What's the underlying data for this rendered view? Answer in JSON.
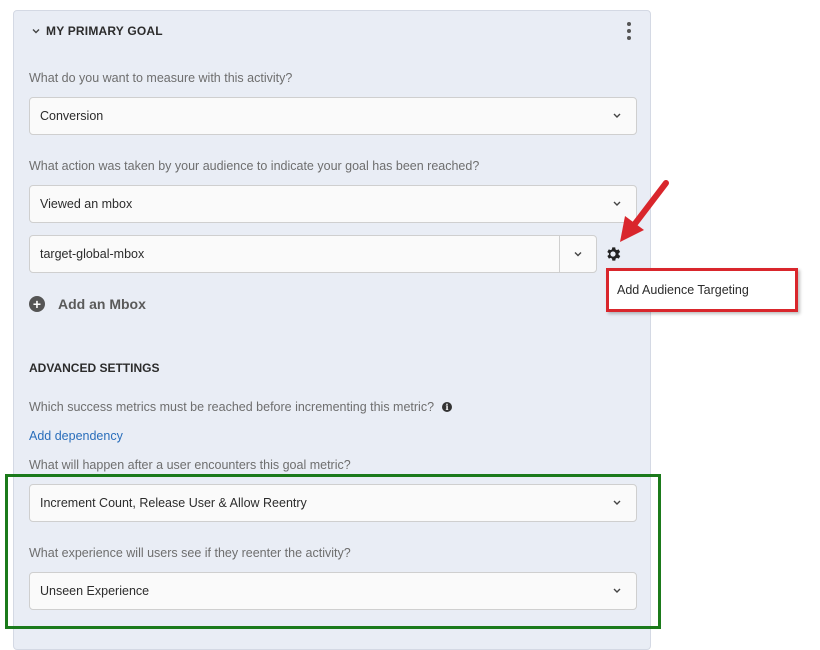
{
  "header": {
    "title": "MY PRIMARY GOAL"
  },
  "measure": {
    "question": "What do you want to measure with this activity?",
    "value": "Conversion"
  },
  "action": {
    "question": "What action was taken by your audience to indicate your goal has been reached?",
    "value": "Viewed an mbox"
  },
  "mbox": {
    "value": "target-global-mbox"
  },
  "add_mbox": {
    "label": "Add an Mbox"
  },
  "popup": {
    "label": "Add Audience Targeting"
  },
  "advanced": {
    "title": "ADVANCED SETTINGS",
    "dependency_question": "Which success metrics must be reached before incrementing this metric?",
    "dependency_link": "Add dependency",
    "encounter_question": "What will happen after a user encounters this goal metric?",
    "encounter_value": "Increment Count, Release User & Allow Reentry",
    "reentry_question": "What experience will users see if they reenter the activity?",
    "reentry_value": "Unseen Experience"
  },
  "colors": {
    "annotation_red": "#d9262c",
    "annotation_green": "#1b7a1b",
    "link_blue": "#2a6ebb"
  }
}
